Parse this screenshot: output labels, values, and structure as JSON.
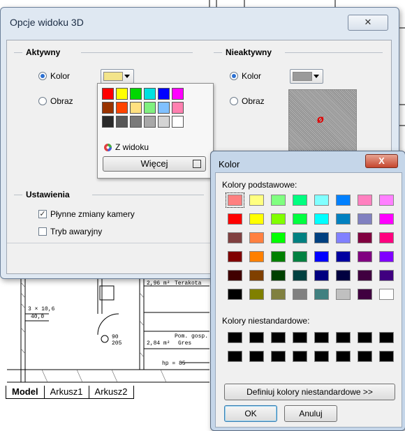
{
  "cad": {
    "tabs": [
      "Model",
      "Arkusz1",
      "Arkusz2"
    ],
    "labels": [
      "2,96 m²",
      "Terakota",
      "Pom. gosp.",
      "2,84 m²",
      "Gres",
      "hp = 85"
    ]
  },
  "opcje_dialog": {
    "title": "Opcje widoku 3D",
    "close_label": "✕",
    "aktywny": {
      "header": "Aktywny",
      "kolor_label": "Kolor",
      "obraz_label": "Obraz",
      "swatch_color": "#f3e48a"
    },
    "nieaktywny": {
      "header": "Nieaktywny",
      "kolor_label": "Kolor",
      "obraz_label": "Obraz",
      "swatch_color": "#9a9a9a",
      "preview_symbol": "ø"
    },
    "ustawienia": {
      "header": "Ustawienia",
      "plynne_label": "Płynne zmiany kamery",
      "plynne_checked": true,
      "tryb_label": "Tryb awaryjny",
      "tryb_checked": false
    }
  },
  "palette_popup": {
    "colors": [
      "#ff0000",
      "#ffff00",
      "#00d800",
      "#00e0e0",
      "#0000ff",
      "#ff00ff",
      "#993300",
      "#ff4400",
      "#ffe080",
      "#80f080",
      "#80c0ff",
      "#ff80b0",
      "#2a2a2a",
      "#585858",
      "#7a7a7a",
      "#a8a8a8",
      "#d4d4d4",
      "#ffffff"
    ],
    "z_widoku_label": "Z widoku",
    "wiecej_label": "Więcej"
  },
  "kolor_dialog": {
    "title": "Kolor",
    "close_label": "X",
    "basic_label": "Kolory podstawowe:",
    "basic_colors": [
      "#ff8080",
      "#ffff80",
      "#80ff80",
      "#00ff80",
      "#80ffff",
      "#0080ff",
      "#ff80c0",
      "#ff80ff",
      "#ff0000",
      "#ffff00",
      "#80ff00",
      "#00ff40",
      "#00ffff",
      "#0080c0",
      "#8080c0",
      "#ff00ff",
      "#804040",
      "#ff8040",
      "#00ff00",
      "#008080",
      "#004080",
      "#8080ff",
      "#800040",
      "#ff0080",
      "#800000",
      "#ff8000",
      "#008000",
      "#008040",
      "#0000ff",
      "#0000a0",
      "#800080",
      "#8000ff",
      "#400000",
      "#804000",
      "#004000",
      "#004040",
      "#000080",
      "#000040",
      "#400040",
      "#400080",
      "#000000",
      "#808000",
      "#808040",
      "#808080",
      "#408080",
      "#c0c0c0",
      "#400040",
      "#ffffff"
    ],
    "custom_label": "Kolory niestandardowe:",
    "custom_colors": [
      "#000000",
      "#000000",
      "#000000",
      "#000000",
      "#000000",
      "#000000",
      "#000000",
      "#000000",
      "#000000",
      "#000000",
      "#000000",
      "#000000",
      "#000000",
      "#000000",
      "#000000",
      "#000000"
    ],
    "define_label": "Definiuj kolory niestandardowe >>",
    "ok_label": "OK",
    "cancel_label": "Anuluj"
  }
}
